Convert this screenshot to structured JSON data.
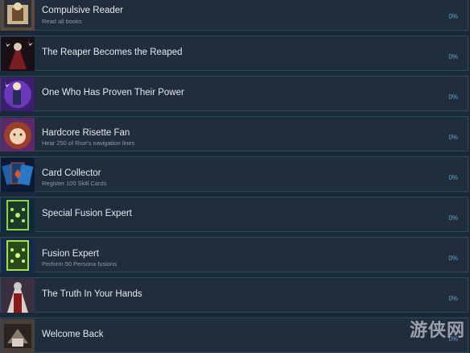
{
  "achievements": [
    {
      "name": "Compulsive Reader",
      "description": "Read all books",
      "percent": "0%",
      "icon": "reader-icon"
    },
    {
      "name": "The Reaper Becomes the Reaped",
      "description": "",
      "percent": "0%",
      "icon": "reaper-icon"
    },
    {
      "name": "One Who Has Proven Their Power",
      "description": "",
      "percent": "0%",
      "icon": "power-icon"
    },
    {
      "name": "Hardcore Risette Fan",
      "description": "Hear 250 of Rise's navigation lines",
      "percent": "0%",
      "icon": "risette-icon"
    },
    {
      "name": "Card Collector",
      "description": "Register 100 Skill Cards",
      "percent": "0%",
      "icon": "cards-icon"
    },
    {
      "name": "Special Fusion Expert",
      "description": "",
      "percent": "0%",
      "icon": "special-fusion-icon"
    },
    {
      "name": "Fusion Expert",
      "description": "Perform 50 Persona fusions",
      "percent": "0%",
      "icon": "fusion-icon"
    },
    {
      "name": "The Truth In Your Hands",
      "description": "",
      "percent": "0%",
      "icon": "truth-icon"
    },
    {
      "name": "Welcome Back",
      "description": "",
      "percent": "0%",
      "icon": "welcome-back-icon"
    }
  ],
  "watermark": "游侠网",
  "colors": {
    "background": "#1b2838",
    "row": "#1f2d3d",
    "row_border": "#2e4a63",
    "percent": "#66a3d2"
  }
}
